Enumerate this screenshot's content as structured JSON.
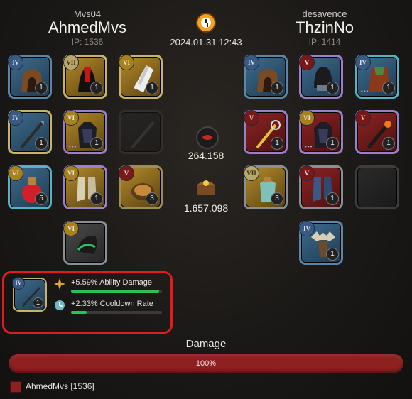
{
  "timestamp": "2024.01.31 12:43",
  "left": {
    "guild": "Mvs04",
    "name": "AhmedMvs",
    "ip": "IP: 1536"
  },
  "right": {
    "guild": "desavence",
    "name": "ThzinNo",
    "ip": "IP: 1414"
  },
  "center": {
    "fame_value": "264.158",
    "silver_value": "1.657.098"
  },
  "left_items": [
    {
      "tier": "IV",
      "qty": "1",
      "icon": "hood-icon"
    },
    {
      "tier": "VII",
      "qty": "1",
      "icon": "robe-icon"
    },
    {
      "tier": "VI",
      "qty": "1",
      "icon": "cape-icon"
    },
    {
      "tier": "IV",
      "qty": "1",
      "icon": "spear-icon"
    },
    {
      "tier": "VI",
      "qty": "1",
      "icon": "armor-icon"
    },
    {
      "tier": "",
      "qty": "",
      "icon": "empty-offhand"
    },
    {
      "tier": "VI",
      "qty": "5",
      "icon": "potion-icon"
    },
    {
      "tier": "VI",
      "qty": "1",
      "icon": "boots-icon"
    },
    {
      "tier": "V",
      "qty": "3",
      "icon": "soup-icon"
    },
    {
      "tier": "VI",
      "qty": "",
      "icon": "horse-helm-icon"
    }
  ],
  "right_items": [
    {
      "tier": "IV",
      "qty": "1",
      "icon": "hood-icon"
    },
    {
      "tier": "V",
      "qty": "1",
      "icon": "helmet-icon"
    },
    {
      "tier": "IV",
      "qty": "1",
      "icon": "cape-icon"
    },
    {
      "tier": "V",
      "qty": "1",
      "icon": "sword-icon"
    },
    {
      "tier": "VI",
      "qty": "1",
      "icon": "armor-icon"
    },
    {
      "tier": "V",
      "qty": "1",
      "icon": "staff-icon"
    },
    {
      "tier": "VII",
      "qty": "3",
      "icon": "bag-potion-icon"
    },
    {
      "tier": "V",
      "qty": "1",
      "icon": "boots-icon"
    },
    {
      "tier": "",
      "qty": "",
      "icon": "empty-slot"
    },
    {
      "tier": "IV",
      "qty": "1",
      "icon": "moose-mount-icon"
    }
  ],
  "bonus": {
    "item_tier": "IV",
    "item_qty": "1",
    "line1": "+5.59% Ability Damage",
    "line1_progress": 0.97,
    "line2": "+2.33% Cooldown Rate",
    "line2_progress": 0.17
  },
  "damage": {
    "title": "Damage",
    "percent": "100%",
    "legend": "AhmedMvs [1536]",
    "color": "#8f2020"
  }
}
